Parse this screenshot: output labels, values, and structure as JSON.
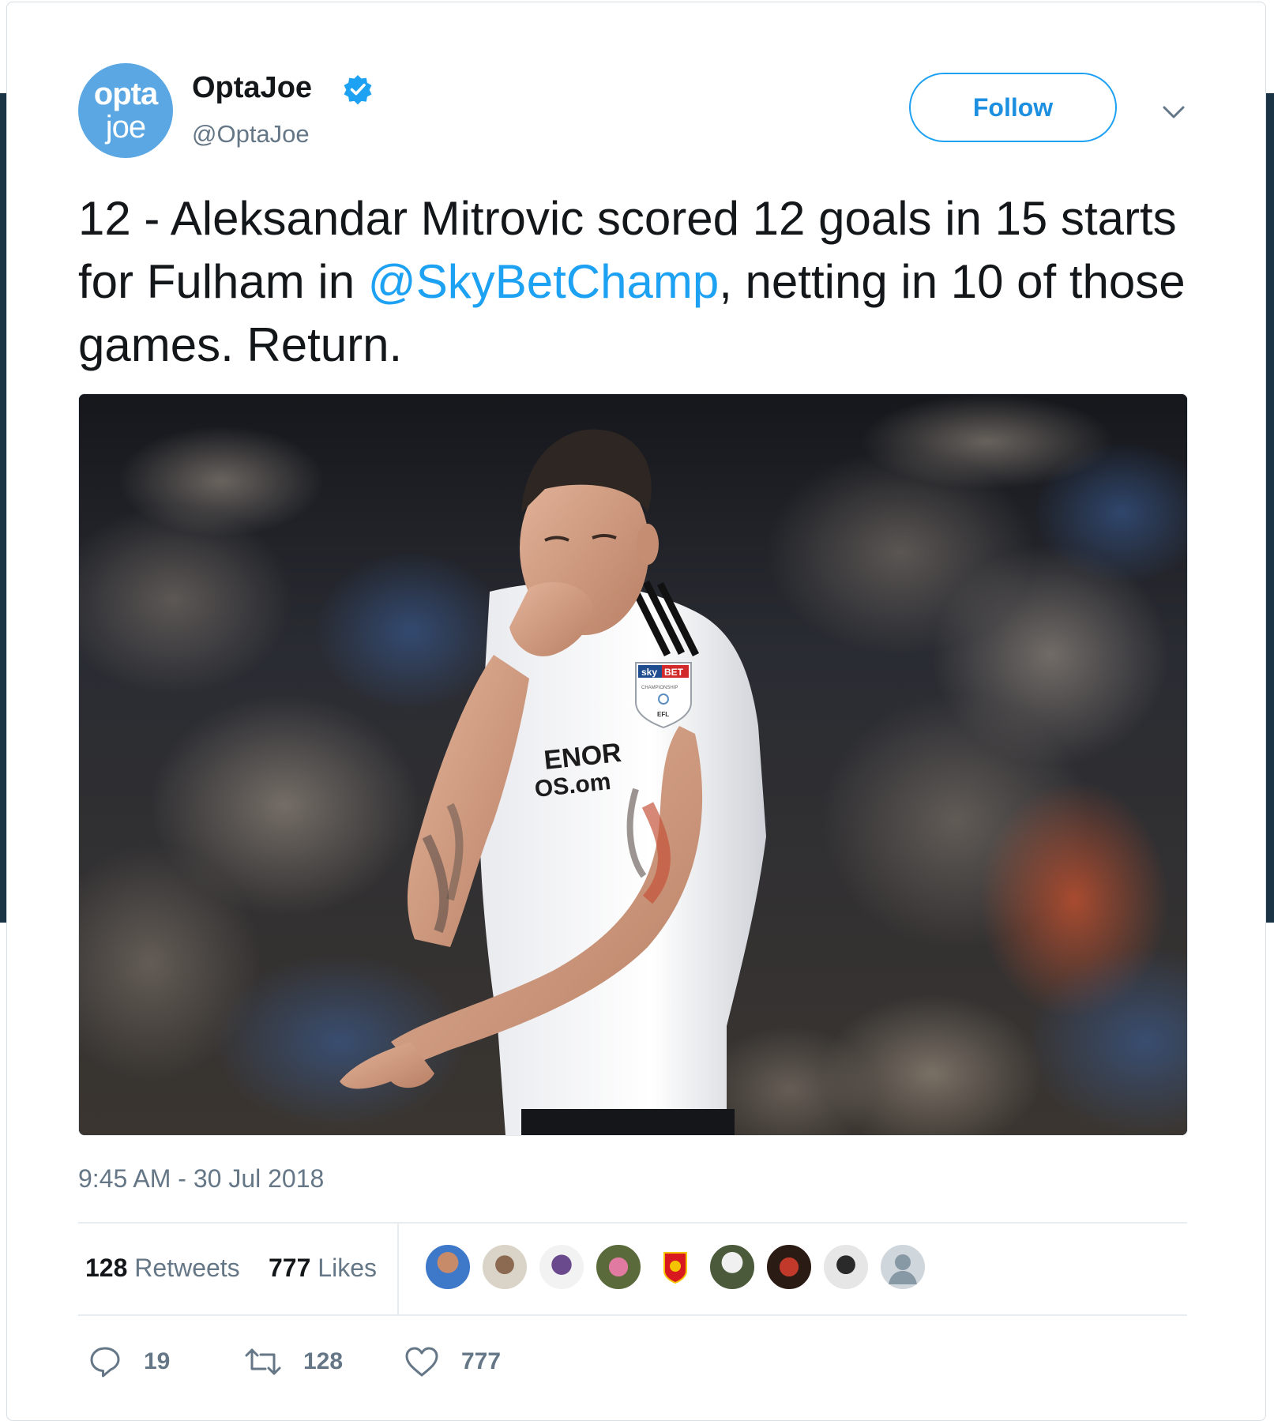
{
  "account": {
    "avatar_line1": "opta",
    "avatar_line2": "joe",
    "display_name": "OptaJoe",
    "handle": "@OptaJoe",
    "verified_icon": "verified-badge-icon"
  },
  "header": {
    "follow_label": "Follow",
    "more_icon": "chevron-down-icon"
  },
  "tweet": {
    "text_part1": "12 - Aleksandar Mitrovic scored 12 goals in 15 starts for Fulham in ",
    "mention": "@SkyBetChamp",
    "text_part2": ", netting in 10 of those games. Return.",
    "timestamp": "9:45 AM - 30 Jul 2018"
  },
  "media": {
    "shirt_badge_line1": "sky",
    "shirt_badge_line2": "BET",
    "shirt_badge_line3": "CHAMPIONSHIP",
    "shirt_badge_line4": "EFL",
    "shirt_sponsor_line1": "ENOR",
    "shirt_sponsor_line2": "OS.om"
  },
  "stats": {
    "retweets_count": "128",
    "retweets_label": "Retweets",
    "likes_count": "777",
    "likes_label": "Likes",
    "likers_count": 9
  },
  "actions": {
    "reply_count": "19",
    "retweet_count": "128",
    "like_count": "777"
  },
  "colors": {
    "brand": "#5aa7e3",
    "link": "#1da1f2",
    "muted": "#657786",
    "text": "#14171a"
  }
}
